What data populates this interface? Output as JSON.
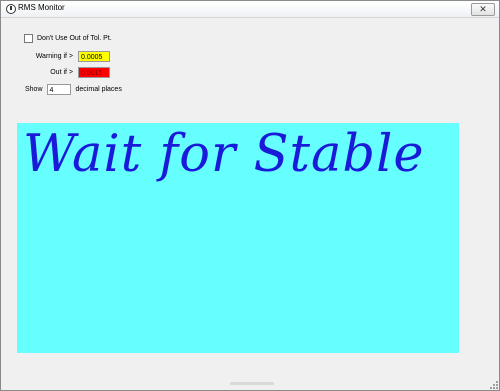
{
  "window": {
    "title": "RMS Monitor",
    "close_glyph": "✕",
    "icon": "app-icon"
  },
  "settings": {
    "dont_use_label": "Don't Use Out of Tol. Pt.",
    "dont_use_checked": false,
    "warning_label": "Warning if >",
    "warning_value": "0.0005",
    "warning_color": "#ffff00",
    "out_label": "Out if >",
    "out_value": "0.0015",
    "out_color": "#ff0000",
    "show_label": "Show",
    "show_value": "4",
    "decimal_label": "decimal places"
  },
  "status": {
    "message": "Wait for Stable",
    "background": "#66ffff",
    "text_color": "#1a1ad9"
  }
}
